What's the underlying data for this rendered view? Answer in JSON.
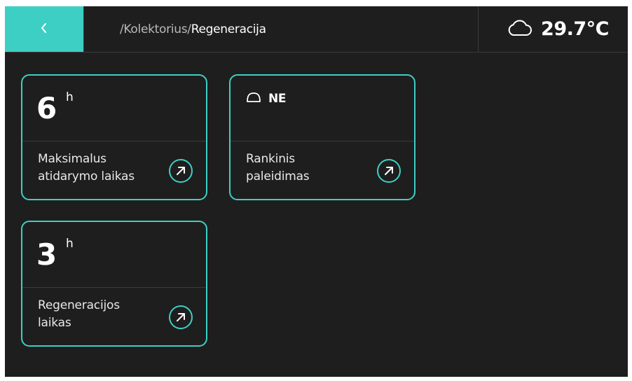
{
  "header": {
    "back_icon": "chevron-left-icon",
    "breadcrumb_path": "/Kolektorius/",
    "breadcrumb_current": "Regeneracija",
    "weather_icon": "cloud-icon",
    "temperature": "29.7°C"
  },
  "cards": [
    {
      "value": "6",
      "unit": "h",
      "label_line1": "Maksimalus",
      "label_line2": "atidarymo laikas",
      "action_icon": "arrow-up-right-icon"
    },
    {
      "status_icon": "dome-icon",
      "status": "NE",
      "label_line1": "Rankinis",
      "label_line2": "paleidimas",
      "action_icon": "arrow-up-right-icon"
    },
    {
      "value": "3",
      "unit": "h",
      "label_line1": "Regeneracijos",
      "label_line2": "laikas",
      "action_icon": "arrow-up-right-icon"
    }
  ],
  "colors": {
    "accent": "#3ecfc4",
    "background": "#1e1e1e",
    "divider": "#3a3a3a",
    "text": "#ffffff"
  }
}
